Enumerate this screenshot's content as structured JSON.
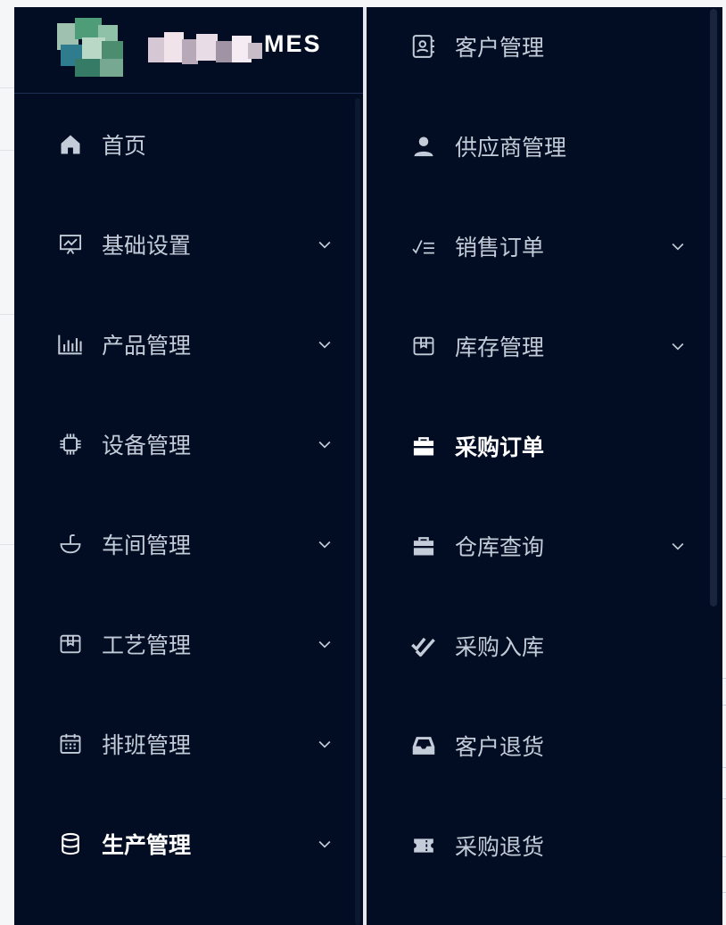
{
  "logo": {
    "text": "MES"
  },
  "left_menu": [
    {
      "label": "首页",
      "icon": "home-icon",
      "expandable": false
    },
    {
      "label": "基础设置",
      "icon": "presentation-chart-icon",
      "expandable": true
    },
    {
      "label": "产品管理",
      "icon": "bar-chart-icon",
      "expandable": true
    },
    {
      "label": "设备管理",
      "icon": "chip-icon",
      "expandable": true
    },
    {
      "label": "车间管理",
      "icon": "basin-icon",
      "expandable": true
    },
    {
      "label": "工艺管理",
      "icon": "package-icon",
      "expandable": true
    },
    {
      "label": "排班管理",
      "icon": "calendar-icon",
      "expandable": true
    },
    {
      "label": "生产管理",
      "icon": "database-icon",
      "expandable": true
    }
  ],
  "right_menu": [
    {
      "label": "客户管理",
      "icon": "contact-book-icon",
      "expandable": false
    },
    {
      "label": "供应商管理",
      "icon": "user-icon",
      "expandable": false
    },
    {
      "label": "销售订单",
      "icon": "checklist-icon",
      "expandable": true
    },
    {
      "label": "库存管理",
      "icon": "package-icon",
      "expandable": true
    },
    {
      "label": "采购订单",
      "icon": "briefcase-icon",
      "expandable": false
    },
    {
      "label": "仓库查询",
      "icon": "briefcase-icon",
      "expandable": true
    },
    {
      "label": "采购入库",
      "icon": "double-check-icon",
      "expandable": false
    },
    {
      "label": "客户退货",
      "icon": "inbox-icon",
      "expandable": false
    },
    {
      "label": "采购退货",
      "icon": "ticket-icon",
      "expandable": false
    }
  ],
  "colors": {
    "sidebar_bg": "#020c22",
    "text": "#c3ccd8",
    "active_text": "#ffffff"
  }
}
